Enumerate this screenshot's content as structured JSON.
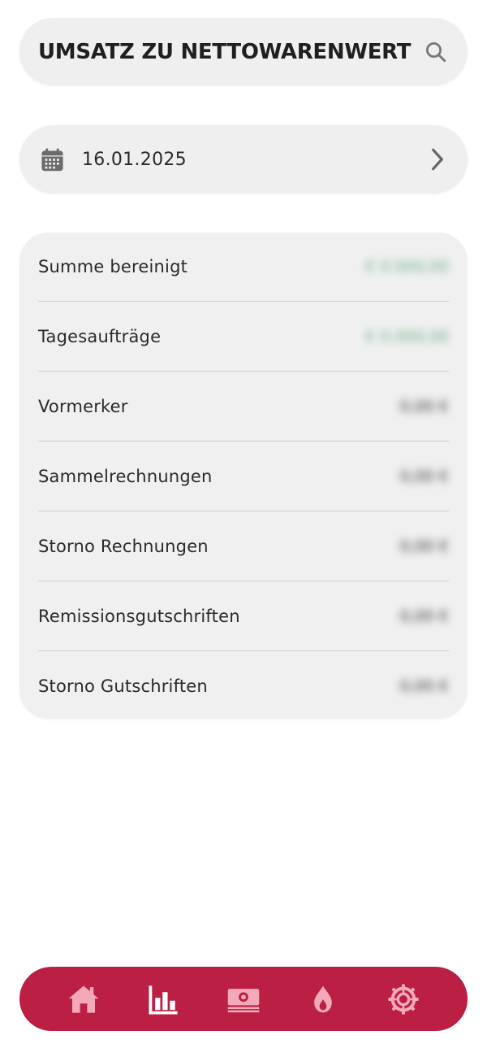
{
  "header": {
    "title": "UMSATZ ZU NETTOWARENWERT",
    "search_icon": "search-icon"
  },
  "date_selector": {
    "date": "16.01.2025",
    "calendar_icon": "calendar-icon",
    "next_icon": "chevron-right-icon"
  },
  "summary": {
    "rows": [
      {
        "label": "Summe bereinigt",
        "value": "€ 0.000,00",
        "value_color": "#6fae8c"
      },
      {
        "label": "Tagesaufträge",
        "value": "€ 0.000,00",
        "value_color": "#6fae8c"
      },
      {
        "label": "Vormerker",
        "value": "0,00 €",
        "value_color": "#3a3a3a"
      },
      {
        "label": "Sammelrechnungen",
        "value": "0,00 €",
        "value_color": "#3a3a3a"
      },
      {
        "label": "Storno Rechnungen",
        "value": "0,00 €",
        "value_color": "#3a3a3a"
      },
      {
        "label": "Remissionsgutschriften",
        "value": "0,00 €",
        "value_color": "#3a3a3a"
      },
      {
        "label": "Storno Gutschriften",
        "value": "0,00 €",
        "value_color": "#3a3a3a"
      }
    ],
    "values_blurred": true
  },
  "bottom_nav": {
    "background": "#bb1f43",
    "active_color": "#ffffff",
    "inactive_color": "#f3a9b9",
    "items": [
      {
        "icon": "home-icon",
        "active": false
      },
      {
        "icon": "bar-chart-icon",
        "active": true
      },
      {
        "icon": "money-icon",
        "active": false
      },
      {
        "icon": "flame-icon",
        "active": false
      },
      {
        "icon": "settings-gear-icon",
        "active": false
      }
    ]
  }
}
